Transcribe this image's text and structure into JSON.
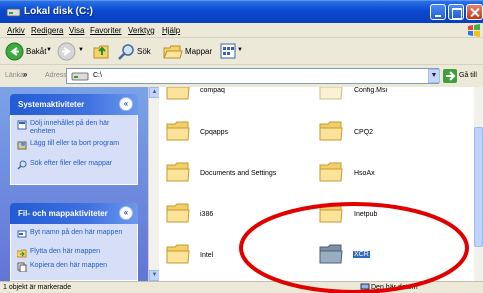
{
  "window": {
    "title": "Lokal disk (C:)"
  },
  "menu": [
    "Arkiv",
    "Redigera",
    "Visa",
    "Favoriter",
    "Verktyg",
    "Hjälp"
  ],
  "toolbar": {
    "back": "Bakåt",
    "search": "Sök",
    "folders": "Mappar"
  },
  "address": {
    "links_label": "Länkar",
    "links_chevron": "»",
    "label": "Adress",
    "value": "C:\\",
    "go_label": "Gå till"
  },
  "tasks": {
    "system": {
      "title": "Systemaktiviteter",
      "items": [
        "Dölj innehållet på den här enheten",
        "Lägg till eller ta bort program",
        "Sök efter filer eller mappar"
      ]
    },
    "file_folder": {
      "title": "Fil- och mappaktiviteter",
      "items": [
        "Byt namn på den här mappen",
        "Flytta den här mappen",
        "Kopiera den här mappen"
      ]
    }
  },
  "files": {
    "left": [
      "compaq",
      "Cpqapps",
      "Documents and Settings",
      "i386",
      "Intel"
    ],
    "right": [
      "Config.Msi",
      "CPQ2",
      "HsoAx",
      "Inetpub",
      "XCR"
    ]
  },
  "status": {
    "text": "1 objekt är markerade",
    "right": "Den här datorn"
  },
  "colors": {
    "title_bar": "#0a48d0",
    "task_pane": "#6c8be0",
    "selection": "#316ac5",
    "annotation": "#e00000"
  }
}
